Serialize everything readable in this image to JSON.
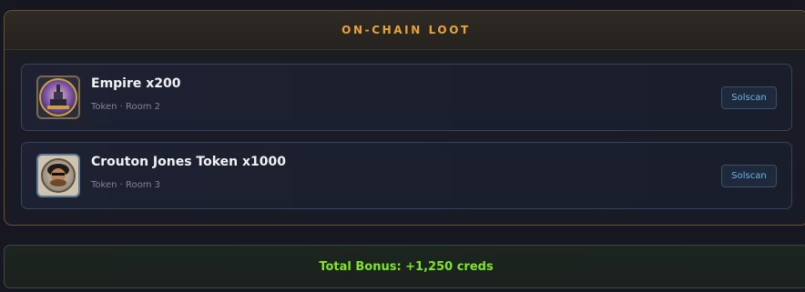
{
  "loot": {
    "title": "ON-CHAIN LOOT",
    "items": [
      {
        "name": "Empire x200",
        "meta": "Token · Room 2",
        "icon": "empire-token-icon",
        "link_label": "Solscan"
      },
      {
        "name": "Crouton Jones Token x1000",
        "meta": "Token · Room 3",
        "icon": "crouton-jones-token-icon",
        "link_label": "Solscan"
      }
    ]
  },
  "bonus": {
    "text": "Total Bonus: +1,250 creds",
    "color": "#7ee622"
  },
  "colors": {
    "accent": "#e8a33a",
    "link": "#6db4ec"
  }
}
